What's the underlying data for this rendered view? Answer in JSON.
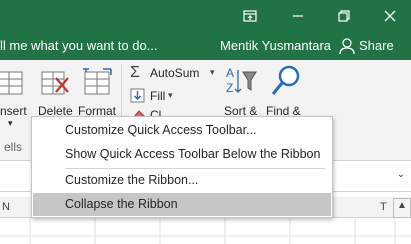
{
  "window": {
    "tell_me": "ll me what you want to do...",
    "user": "Mentik Yusmantara",
    "share_label": "Share"
  },
  "ribbon": {
    "insert_label": "nsert",
    "delete_label": "Delete",
    "format_label": "Format",
    "autosum_label": "AutoSum",
    "fill_label": "Fill",
    "clear_label": "Cl",
    "sort_label": "Sort &",
    "find_label": "Find &",
    "group_label": "ells"
  },
  "context_menu": {
    "items": [
      {
        "label": "Customize Quick Access Toolbar..."
      },
      {
        "label": "Show Quick Access Toolbar Below the Ribbon"
      },
      {
        "label": "Customize the Ribbon..."
      },
      {
        "label": "Collapse the Ribbon"
      }
    ]
  },
  "sheet": {
    "col_left": "N",
    "col_right": "T"
  },
  "colors": {
    "title_green": "#217346",
    "ribbon_bg": "#f3f3f3",
    "menu_hover": "#c6c6c6",
    "delete_red": "#c0392b",
    "find_blue": "#2b6cb0"
  }
}
